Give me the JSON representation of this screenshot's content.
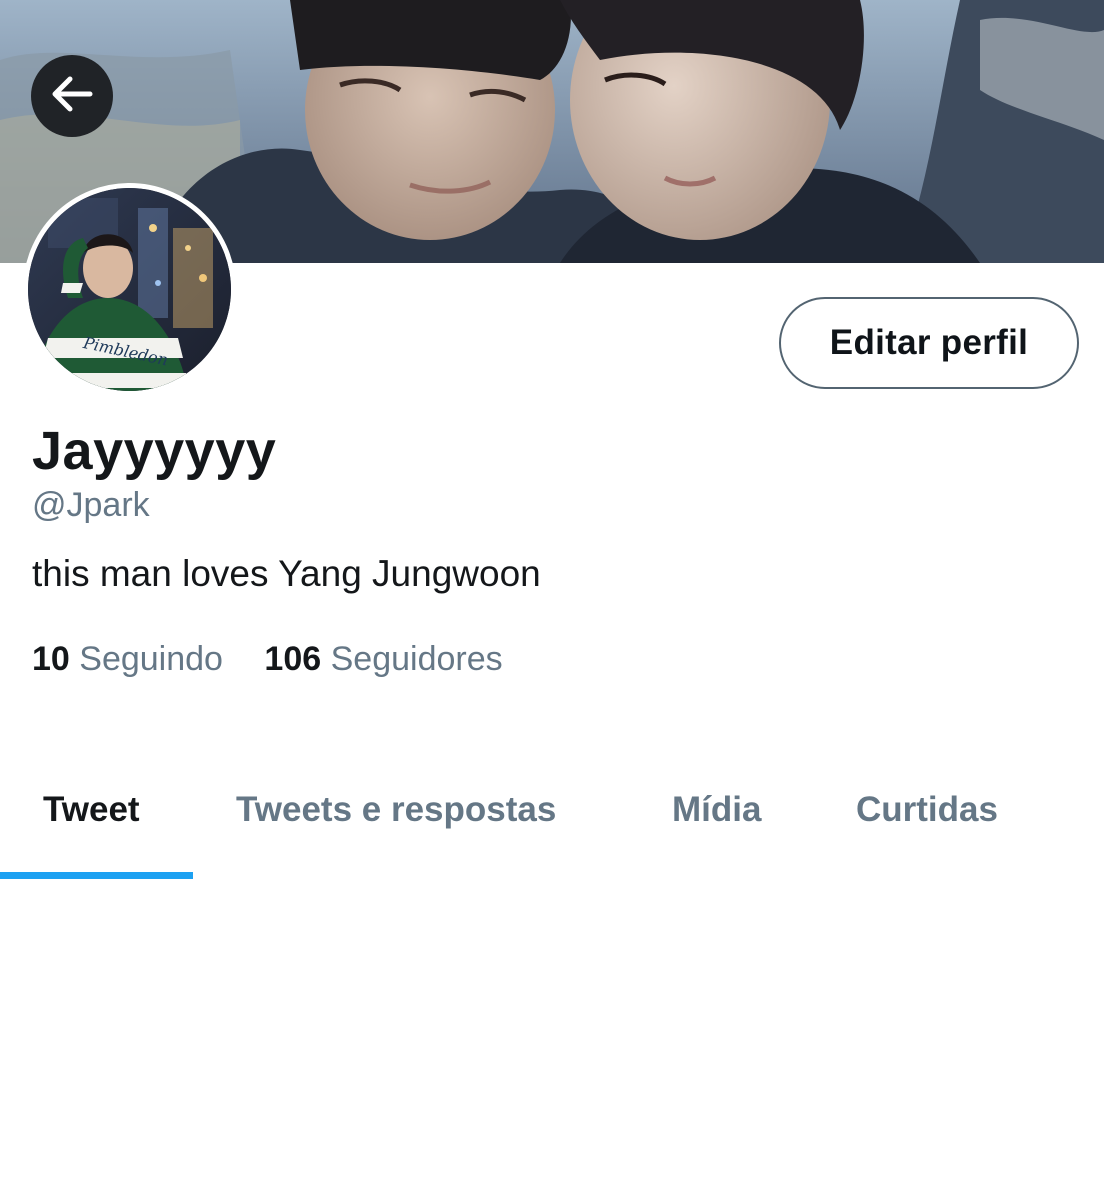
{
  "profile": {
    "display_name": "Jayyyyyy",
    "handle": "@Jpark",
    "bio": "this man loves Yang Jungwoon"
  },
  "actions": {
    "edit_profile_label": "Editar perfil"
  },
  "stats": {
    "following_count": "10",
    "following_label": "Seguindo",
    "followers_count": "106",
    "followers_label": "Seguidores"
  },
  "tabs": [
    {
      "label": "Tweet",
      "active": true
    },
    {
      "label": "Tweets e respostas",
      "active": false
    },
    {
      "label": "Mídia",
      "active": false
    },
    {
      "label": "Curtidas",
      "active": false
    }
  ],
  "colors": {
    "accent": "#1da1f2",
    "primary_text": "#14171a",
    "secondary_text": "#657786"
  },
  "icons": {
    "back": "arrow-left-icon"
  }
}
